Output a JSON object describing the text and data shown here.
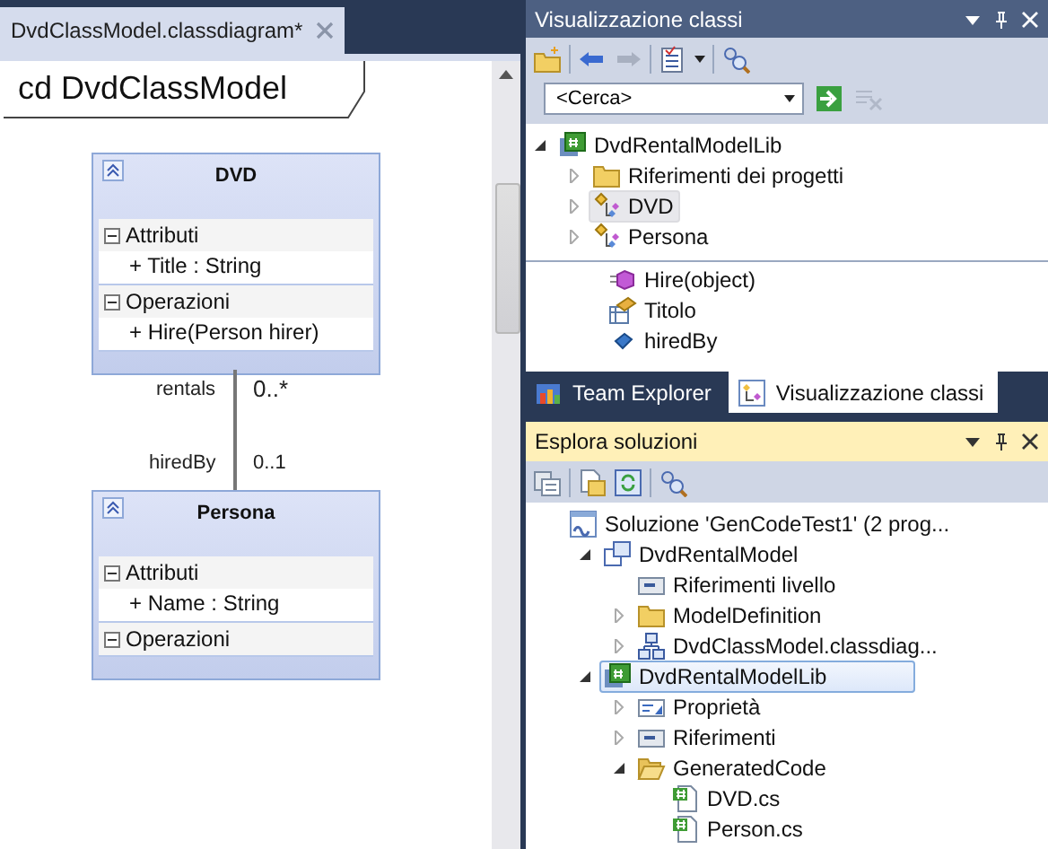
{
  "document_tab": {
    "title": "DvdClassModel.classdiagram*",
    "selected": true
  },
  "diagram": {
    "frame_label": "cd DvdClassModel",
    "classes": [
      {
        "name": "DVD",
        "compartments": [
          {
            "title": "Attributi",
            "expanded": true,
            "members": [
              "+ Title : String"
            ]
          },
          {
            "title": "Operazioni",
            "expanded": true,
            "members": [
              "+ Hire(Person hirer)"
            ]
          }
        ]
      },
      {
        "name": "Persona",
        "compartments": [
          {
            "title": "Attributi",
            "expanded": true,
            "members": [
              "+ Name : String"
            ]
          },
          {
            "title": "Operazioni",
            "expanded": true
          }
        ]
      }
    ],
    "association": {
      "source_role": "rentals",
      "source_multiplicity": "0..*",
      "target_role": "hiredBy",
      "target_multiplicity": "0..1"
    }
  },
  "class_view": {
    "title": "Visualizzazione classi",
    "search": {
      "value": "<Cerca>"
    },
    "tree": [
      {
        "label": "DvdRentalModelLib",
        "kind": "cs-project",
        "expanded": true,
        "selected": false,
        "children": [
          {
            "label": "Riferimenti dei progetti",
            "kind": "folder",
            "expanded": false,
            "selected": false
          },
          {
            "label": "DVD",
            "kind": "class",
            "expanded": false,
            "selected": true
          },
          {
            "label": "Persona",
            "kind": "class",
            "expanded": false,
            "selected": false
          }
        ]
      }
    ],
    "members": [
      {
        "label": "Hire(object)",
        "kind": "method"
      },
      {
        "label": "Titolo",
        "kind": "property"
      },
      {
        "label": "hiredBy",
        "kind": "field"
      }
    ]
  },
  "bottom_tabs": [
    {
      "label": "Team Explorer",
      "kind": "team",
      "selected": false
    },
    {
      "label": "Visualizzazione classi",
      "kind": "classview",
      "selected": true
    }
  ],
  "solution_explorer": {
    "title": "Esplora soluzioni",
    "tree": [
      {
        "label": "Soluzione 'GenCodeTest1' (2 prog...",
        "kind": "solution",
        "selected": false,
        "children": [
          {
            "label": "DvdRentalModel",
            "kind": "model-project",
            "expanded": true,
            "selected": false,
            "children": [
              {
                "label": "Riferimenti livello",
                "kind": "references",
                "selected": false
              },
              {
                "label": "ModelDefinition",
                "kind": "folder",
                "expanded": false,
                "selected": false
              },
              {
                "label": "DvdClassModel.classdiag...",
                "kind": "diagram",
                "expanded": false,
                "selected": false
              }
            ]
          },
          {
            "label": "DvdRentalModelLib",
            "kind": "cs-project",
            "expanded": true,
            "selected": true,
            "children": [
              {
                "label": "Proprietà",
                "kind": "properties",
                "expanded": false,
                "selected": false
              },
              {
                "label": "Riferimenti",
                "kind": "references",
                "expanded": false,
                "selected": false
              },
              {
                "label": "GeneratedCode",
                "kind": "folder-open",
                "expanded": true,
                "selected": false,
                "children": [
                  {
                    "label": "DVD.cs",
                    "kind": "cs-file",
                    "selected": false
                  },
                  {
                    "label": "Person.cs",
                    "kind": "cs-file",
                    "selected": false
                  }
                ]
              }
            ]
          }
        ]
      }
    ]
  }
}
